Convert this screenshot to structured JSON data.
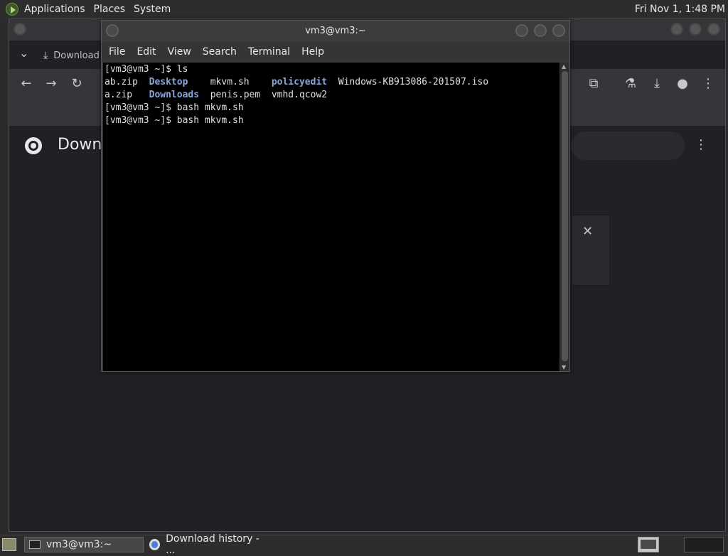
{
  "top_panel": {
    "menu": [
      "Applications",
      "Places",
      "System"
    ],
    "clock": "Fri Nov 1, 1:48 PM"
  },
  "browser": {
    "tab_label": "Download",
    "page_title": "Downl",
    "close_glyph": "✕",
    "menu_glyph": "⋮"
  },
  "terminal": {
    "title": "vm3@vm3:~",
    "menu": [
      "File",
      "Edit",
      "View",
      "Search",
      "Terminal",
      "Help"
    ],
    "lines": [
      [
        {
          "t": "[vm3@vm3 ~]$ ls"
        }
      ],
      [
        {
          "t": "ab.zip  "
        },
        {
          "t": "Desktop",
          "dir": true
        },
        {
          "t": "    mkvm.sh    "
        },
        {
          "t": "policyedit",
          "dir": true
        },
        {
          "t": "  Windows-KB913086-201507.iso"
        }
      ],
      [
        {
          "t": "a.zip   "
        },
        {
          "t": "Downloads",
          "dir": true
        },
        {
          "t": "  penis.pem  vmhd.qcow2"
        }
      ],
      [
        {
          "t": "[vm3@vm3 ~]$ bash mkvm.sh"
        }
      ],
      [
        {
          "t": "[vm3@vm3 ~]$ bash mkvm.sh"
        }
      ]
    ]
  },
  "taskbar": {
    "terminal_task": "vm3@vm3:~",
    "chrome_task": "Download history - ..."
  },
  "icons": {
    "back": "←",
    "forward": "→",
    "reload": "↻",
    "extensions": "⧉",
    "labs": "⚗",
    "download": "⤓",
    "profile": "●",
    "menu": "⋮",
    "chevron": "⌄"
  }
}
